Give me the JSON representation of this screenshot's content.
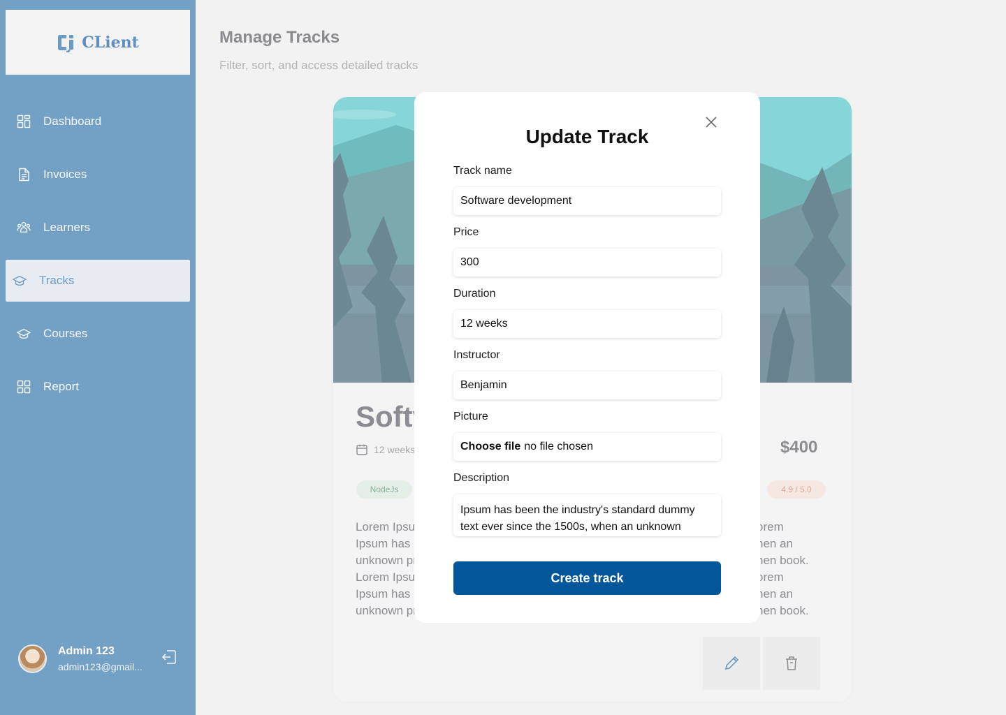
{
  "brand": {
    "name": "CLient"
  },
  "sidebar": {
    "items": [
      {
        "label": "Dashboard",
        "icon": "dashboard-icon"
      },
      {
        "label": "Invoices",
        "icon": "document-icon"
      },
      {
        "label": "Learners",
        "icon": "people-icon"
      },
      {
        "label": "Tracks",
        "icon": "graduation-cap-icon",
        "active": true
      },
      {
        "label": "Courses",
        "icon": "graduation-cap-icon"
      },
      {
        "label": "Report",
        "icon": "dashboard-icon"
      }
    ],
    "user": {
      "name": "Admin 123",
      "email": "admin123@gmail..."
    }
  },
  "header": {
    "title": "Manage Tracks",
    "subtitle": "Filter, sort, and access detailed tracks"
  },
  "card": {
    "title_visible": "Softv",
    "duration": "12 weeks",
    "price": "$400",
    "tag": "NodeJs",
    "rating": "4.9 / 5.0",
    "desc_left": "Lorem Ipsu\nIpsum has l\nunknown pr\nLorem Ipsu\nIpsum has l\nunknown pr",
    "desc_right": "orem\nhen an\nhen book.\norem\nhen an\nhen book."
  },
  "modal": {
    "title": "Update Track",
    "fields": {
      "track_name": {
        "label": "Track name",
        "value": "Software development"
      },
      "price": {
        "label": "Price",
        "value": "300"
      },
      "duration": {
        "label": "Duration",
        "value": "12 weeks"
      },
      "instructor": {
        "label": "Instructor",
        "value": "Benjamin"
      },
      "picture": {
        "label": "Picture",
        "button": "Choose file",
        "status": "no file chosen"
      },
      "description": {
        "label": "Description",
        "value": "Ipsum has been the industry's standard dummy text ever since the 1500s, when an unknown"
      }
    },
    "submit_label": "Create track"
  },
  "colors": {
    "sidebar_bg": "#73a1c5",
    "primary_button": "#035699",
    "active_nav_text": "#6b9ac2"
  }
}
